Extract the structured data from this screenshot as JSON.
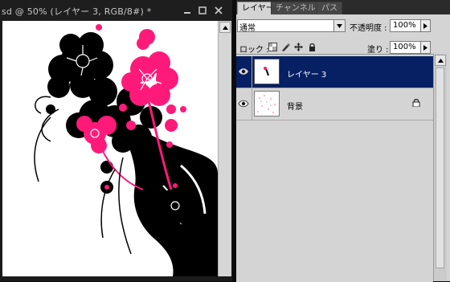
{
  "document": {
    "title": "sd @ 50% (レイヤー 3, RGB/8#) *",
    "window_buttons": [
      "minimize-icon",
      "maximize-icon",
      "close-icon"
    ]
  },
  "panel": {
    "tabs": [
      {
        "label": "レイヤー",
        "active": true
      },
      {
        "label": "チャンネル",
        "active": false
      },
      {
        "label": "パス",
        "active": false
      }
    ],
    "blend_mode": "通常",
    "opacity_label": "不透明度 :",
    "opacity_value": "100%",
    "lock_label": "ロック :",
    "lock_icons": [
      "lock-transparency-icon",
      "lock-image-icon",
      "lock-position-icon",
      "lock-all-icon"
    ],
    "fill_label": "塗り :",
    "fill_value": "100%",
    "layers": [
      {
        "name": "レイヤー 3",
        "selected": true,
        "visible": true,
        "locked": false
      },
      {
        "name": "背景",
        "selected": false,
        "visible": true,
        "locked": true
      }
    ]
  },
  "colors": {
    "accent_pink": "#ff1a7a",
    "selection_blue": "#062063",
    "panel_gray": "#d4d4d4"
  }
}
